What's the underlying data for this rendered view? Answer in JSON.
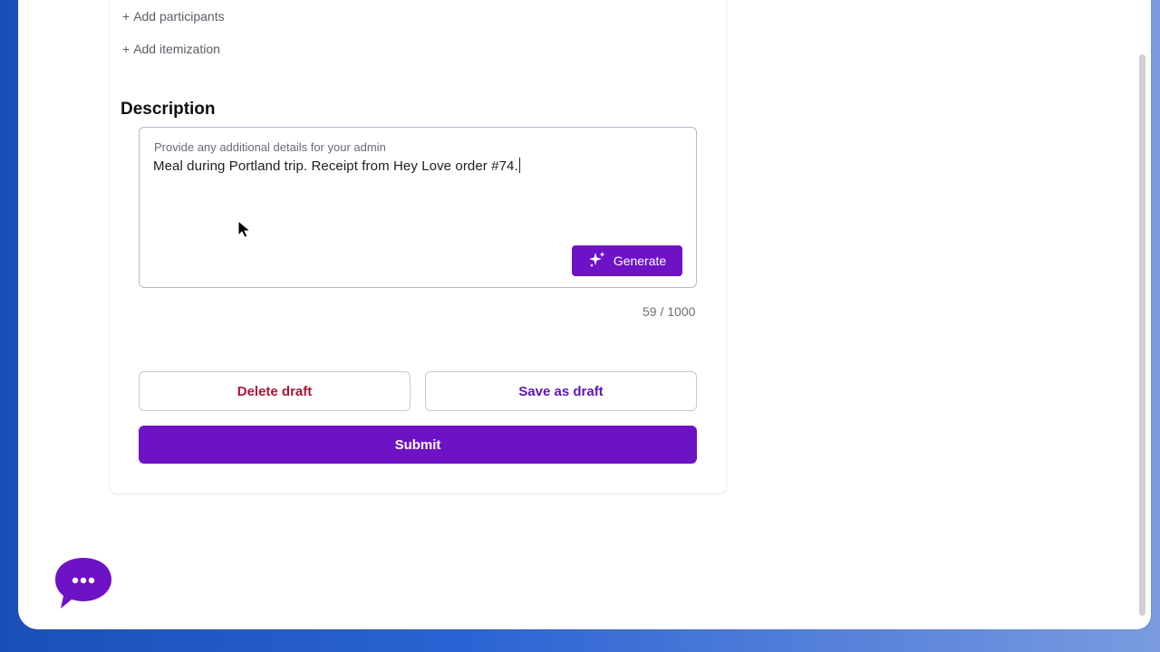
{
  "form": {
    "add_participants": "Add participants",
    "add_itemization": "Add itemization",
    "plus_symbol": "+",
    "description": {
      "title": "Description",
      "label": "Provide any additional details for your admin",
      "value": "Meal during Portland trip. Receipt from Hey Love order #74.",
      "generate_label": "Generate",
      "counter": "59 / 1000"
    },
    "delete_label": "Delete draft",
    "save_label": "Save as draft",
    "submit_label": "Submit"
  },
  "icons": {
    "generate": "sparkle-icon",
    "chat": "chat-bubble-icon",
    "cursor": "mouse-pointer-icon"
  },
  "colors": {
    "accent": "#6e12c6",
    "danger": "#b0123a",
    "secondary": "#5d17b8"
  }
}
